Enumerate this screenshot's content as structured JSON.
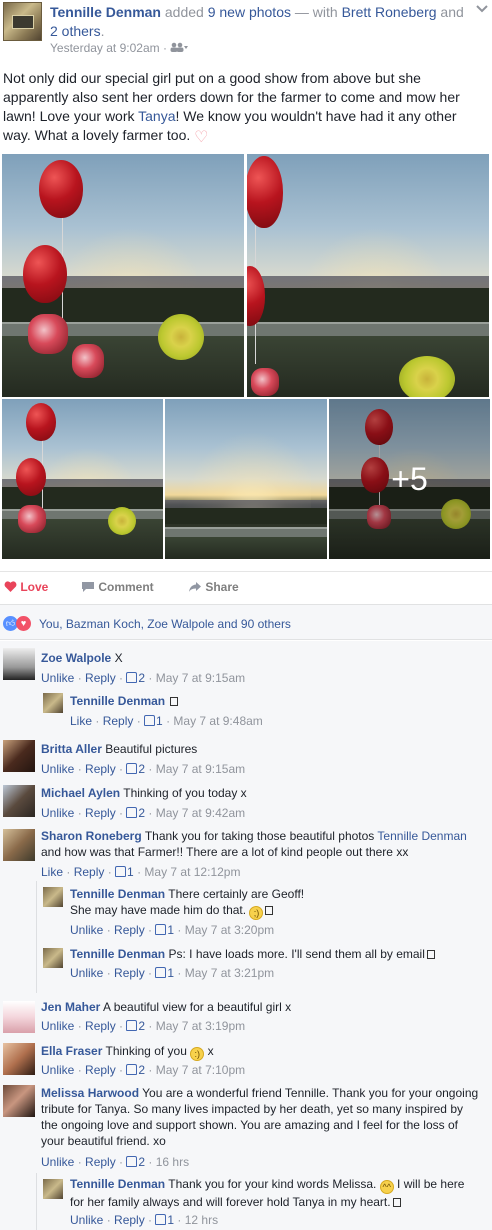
{
  "post": {
    "author": "Tennille Denman",
    "verb": "added",
    "photos_link": "9 new photos",
    "with_text": "— with",
    "tagged": "Brett Roneberg",
    "and_text": "and",
    "others_link": "2 others",
    "timestamp": "Yesterday at 9:02am",
    "audience_icon": "friends-icon",
    "text_part1": "Not only did our special girl put on a good show from above but she apparently also sent her orders down for the farmer to come and mow her lawn! Love your work ",
    "text_mention": "Tanya",
    "text_part2": "! We know you wouldn't have had it any other way. What a lovely farmer too.",
    "photo_more": "+5"
  },
  "actions": {
    "love": "Love",
    "comment": "Comment",
    "share": "Share"
  },
  "reactions": {
    "summary": "You, Bazman Koch, Zoe Walpole and 90 others"
  },
  "comments": [
    {
      "author": "Zoe Walpole",
      "text": "X",
      "action": "Unlike",
      "reply": "Reply",
      "likes": "2",
      "time": "May 7 at 9:15am"
    },
    {
      "author": "Tennille Denman",
      "text": "",
      "action": "Like",
      "reply": "Reply",
      "likes": "1",
      "time": "May 7 at 9:48am"
    },
    {
      "author": "Britta Aller",
      "text": "Beautiful pictures",
      "action": "Unlike",
      "reply": "Reply",
      "likes": "2",
      "time": "May 7 at 9:15am"
    },
    {
      "author": "Michael Aylen",
      "text": "Thinking of you today x",
      "action": "Unlike",
      "reply": "Reply",
      "likes": "2",
      "time": "May 7 at 9:42am"
    },
    {
      "author": "Sharon Roneberg",
      "text_a": "Thank you for taking those beautiful photos",
      "mention": "Tennille Denman",
      "text_b": "and how was that Farmer!! There are a lot of kind people out there xx",
      "action": "Like",
      "reply": "Reply",
      "likes": "1",
      "time": "May 7 at 12:12pm"
    },
    {
      "author": "Tennille Denman",
      "text": "There certainly are Geoff!",
      "text2": "She may have made him do that.",
      "action": "Unlike",
      "reply": "Reply",
      "likes": "1",
      "time": "May 7 at 3:20pm"
    },
    {
      "author": "Tennille Denman",
      "text": "Ps: I have loads more. I'll send them all by email",
      "action": "Unlike",
      "reply": "Reply",
      "likes": "1",
      "time": "May 7 at 3:21pm"
    },
    {
      "author": "Jen Maher",
      "text": "A beautiful view for a beautiful girl x",
      "action": "Unlike",
      "reply": "Reply",
      "likes": "2",
      "time": "May 7 at 3:19pm"
    },
    {
      "author": "Ella Fraser",
      "text": "Thinking of you",
      "text_tail": "x",
      "action": "Unlike",
      "reply": "Reply",
      "likes": "2",
      "time": "May 7 at 7:10pm"
    },
    {
      "author": "Melissa Harwood",
      "text": "You are a wonderful friend Tennille. Thank you for your ongoing tribute for Tanya. So many lives impacted by her death, yet so many inspired by the ongoing love and support shown. You are amazing and I feel for the loss of your beautiful friend. xo",
      "action": "Unlike",
      "reply": "Reply",
      "likes": "2",
      "time": "16 hrs"
    },
    {
      "author": "Tennille Denman",
      "text": "Thank you for your kind words Melissa.",
      "text_b": "I will be here for her family always and will forever hold Tanya in my heart.",
      "action": "Unlike",
      "reply": "Reply",
      "likes": "1",
      "time": "12 hrs"
    }
  ],
  "colors": {
    "link": "#365899",
    "love": "#e9445a",
    "meta": "#90949c",
    "comment_bg": "#f6f7f9"
  }
}
